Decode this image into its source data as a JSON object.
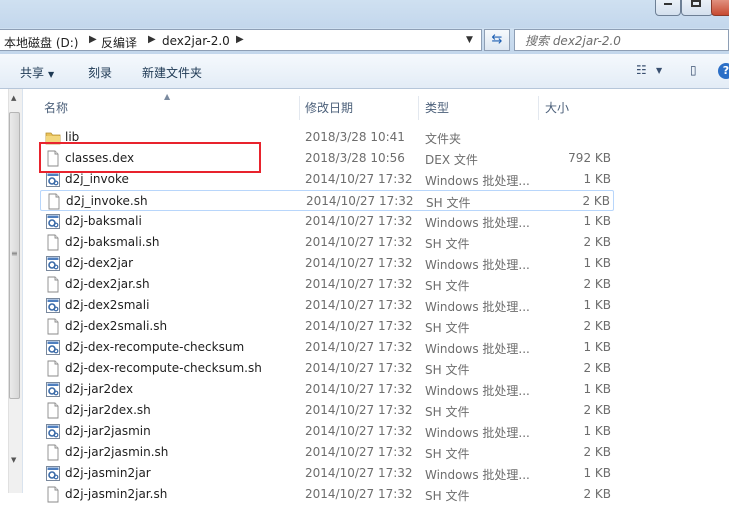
{
  "address": {
    "crumbs": [
      "本地磁盘 (D:)",
      "反编译",
      "dex2jar-2.0"
    ]
  },
  "search": {
    "placeholder": "搜索 dex2jar-2.0"
  },
  "toolbar": {
    "share_label": "共享",
    "burn_label": "刻录",
    "new_folder_label": "新建文件夹"
  },
  "columns": {
    "name": "名称",
    "date": "修改日期",
    "type": "类型",
    "size": "大小"
  },
  "files": [
    {
      "name": "lib",
      "date": "2018/3/28 10:41",
      "type": "文件夹",
      "size": "",
      "icon": "folder-icon"
    },
    {
      "name": "classes.dex",
      "date": "2018/3/28 10:56",
      "type": "DEX 文件",
      "size": "792 KB",
      "icon": "file-icon"
    },
    {
      "name": "d2j_invoke",
      "date": "2014/10/27 17:32",
      "type": "Windows 批处理...",
      "size": "1 KB",
      "icon": "batch-file-icon"
    },
    {
      "name": "d2j_invoke.sh",
      "date": "2014/10/27 17:32",
      "type": "SH 文件",
      "size": "2 KB",
      "icon": "file-icon"
    },
    {
      "name": "d2j-baksmali",
      "date": "2014/10/27 17:32",
      "type": "Windows 批处理...",
      "size": "1 KB",
      "icon": "batch-file-icon"
    },
    {
      "name": "d2j-baksmali.sh",
      "date": "2014/10/27 17:32",
      "type": "SH 文件",
      "size": "2 KB",
      "icon": "file-icon"
    },
    {
      "name": "d2j-dex2jar",
      "date": "2014/10/27 17:32",
      "type": "Windows 批处理...",
      "size": "1 KB",
      "icon": "batch-file-icon"
    },
    {
      "name": "d2j-dex2jar.sh",
      "date": "2014/10/27 17:32",
      "type": "SH 文件",
      "size": "2 KB",
      "icon": "file-icon"
    },
    {
      "name": "d2j-dex2smali",
      "date": "2014/10/27 17:32",
      "type": "Windows 批处理...",
      "size": "1 KB",
      "icon": "batch-file-icon"
    },
    {
      "name": "d2j-dex2smali.sh",
      "date": "2014/10/27 17:32",
      "type": "SH 文件",
      "size": "2 KB",
      "icon": "file-icon"
    },
    {
      "name": "d2j-dex-recompute-checksum",
      "date": "2014/10/27 17:32",
      "type": "Windows 批处理...",
      "size": "1 KB",
      "icon": "batch-file-icon"
    },
    {
      "name": "d2j-dex-recompute-checksum.sh",
      "date": "2014/10/27 17:32",
      "type": "SH 文件",
      "size": "2 KB",
      "icon": "file-icon"
    },
    {
      "name": "d2j-jar2dex",
      "date": "2014/10/27 17:32",
      "type": "Windows 批处理...",
      "size": "1 KB",
      "icon": "batch-file-icon"
    },
    {
      "name": "d2j-jar2dex.sh",
      "date": "2014/10/27 17:32",
      "type": "SH 文件",
      "size": "2 KB",
      "icon": "file-icon"
    },
    {
      "name": "d2j-jar2jasmin",
      "date": "2014/10/27 17:32",
      "type": "Windows 批处理...",
      "size": "1 KB",
      "icon": "batch-file-icon"
    },
    {
      "name": "d2j-jar2jasmin.sh",
      "date": "2014/10/27 17:32",
      "type": "SH 文件",
      "size": "2 KB",
      "icon": "file-icon"
    },
    {
      "name": "d2j-jasmin2jar",
      "date": "2014/10/27 17:32",
      "type": "Windows 批处理...",
      "size": "1 KB",
      "icon": "batch-file-icon"
    },
    {
      "name": "d2j-jasmin2jar.sh",
      "date": "2014/10/27 17:32",
      "type": "SH 文件",
      "size": "2 KB",
      "icon": "file-icon"
    }
  ]
}
